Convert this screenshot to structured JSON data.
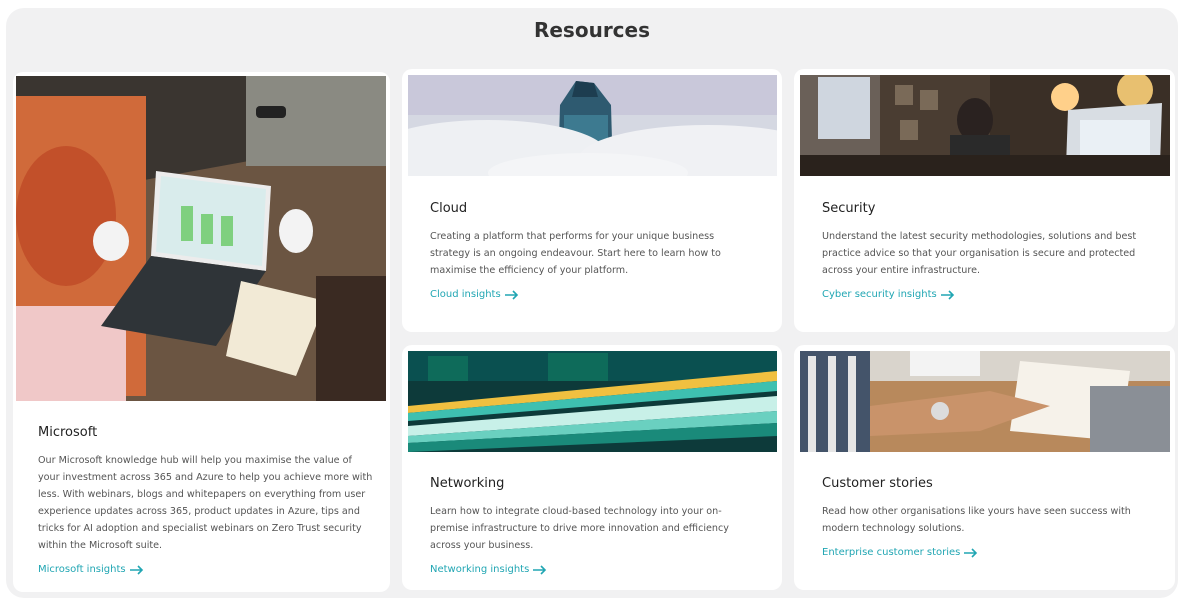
{
  "header": {
    "title": "Resources"
  },
  "colors": {
    "accent": "#21a6b3",
    "panel_bg": "#f1f1f2",
    "card_bg": "#ffffff"
  },
  "cards": [
    {
      "title": "Microsoft",
      "description": "Our Microsoft knowledge hub will help you maximise the value of your investment across 365 and Azure to help you achieve more with less. With webinars, blogs and whitepapers on everything from user experience updates across 365, product updates in Azure, tips and tricks for AI adoption and specialist webinars on Zero Trust security within the Microsoft suite.",
      "link": "Microsoft insights",
      "image": "team-laptop-photo"
    },
    {
      "title": "Cloud",
      "description": "Creating a platform that performs for your unique business strategy is an ongoing endeavour. Start here to learn how to maximise the efficiency of your platform.",
      "link": "Cloud insights",
      "image": "skyscraper-clouds-photo"
    },
    {
      "title": "Security",
      "description": "Understand the latest security methodologies, solutions and best practice advice so that your organisation is secure and protected across your entire infrastructure.",
      "link": "Cyber security insights",
      "image": "security-office-photo"
    },
    {
      "title": "Networking",
      "description": "Learn how to integrate cloud-based technology into your on-premise infrastructure to drive more innovation and efficiency across your business.",
      "link": "Networking insights",
      "image": "light-trails-photo"
    },
    {
      "title": "Customer stories",
      "description": "Read how other organisations like yours have seen success with modern technology solutions.",
      "link": "Enterprise customer stories",
      "image": "handshake-photo"
    }
  ]
}
